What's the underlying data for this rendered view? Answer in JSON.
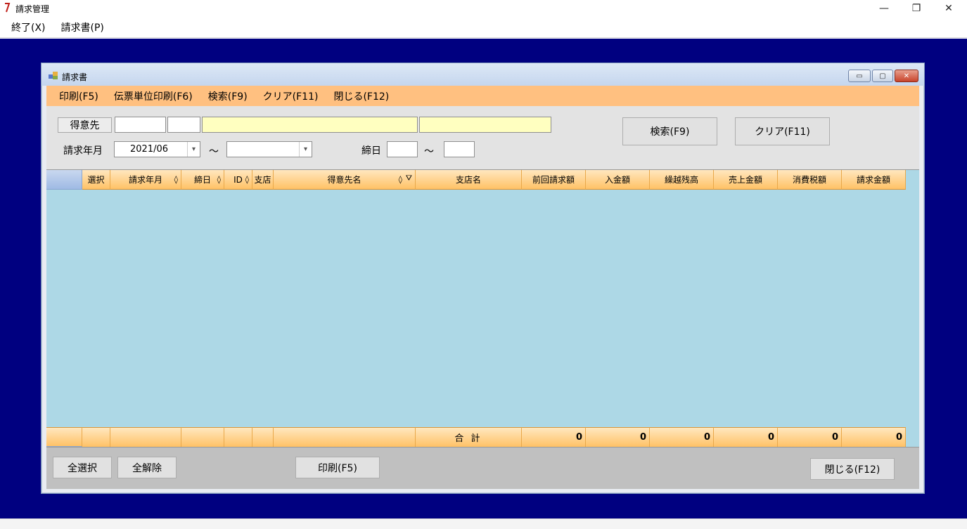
{
  "app": {
    "title": "請求管理",
    "minimize": "—",
    "restore": "❐",
    "close": "✕",
    "menu": [
      "終了(X)",
      "請求書(P)"
    ]
  },
  "window": {
    "title": "請求書",
    "minimize": "▭",
    "maximize": "▢",
    "close": "✕",
    "menu": [
      "印刷(F5)",
      "伝票単位印刷(F6)",
      "検索(F9)",
      "クリア(F11)",
      "閉じる(F12)"
    ]
  },
  "filter": {
    "customer_label": "得意先",
    "billing_month_label": "請求年月",
    "billing_month_from": "2021/06",
    "billing_month_to": "",
    "tilde": "～",
    "closing_day_label": "締日",
    "search_button": "検索(F9)",
    "clear_button": "クリア(F11)"
  },
  "grid": {
    "columns": [
      "選択",
      "請求年月",
      "締日",
      "ID",
      "支店",
      "得意先名",
      "支店名",
      "前回請求額",
      "入金額",
      "繰越残高",
      "売上金額",
      "消費税額",
      "請求金額"
    ],
    "sort_glyph": "◊",
    "filter_glyph": "⛛",
    "footer_label": "合 計",
    "totals": [
      "0",
      "0",
      "0",
      "0",
      "0",
      "0"
    ]
  },
  "buttons": {
    "select_all": "全選択",
    "deselect_all": "全解除",
    "print": "印刷(F5)",
    "close": "閉じる(F12)"
  },
  "colors": {
    "mdi_background": "#000080",
    "menu_orange": "#ffc080",
    "grid_background": "#add8e6",
    "highlight_field": "#ffffc0"
  }
}
